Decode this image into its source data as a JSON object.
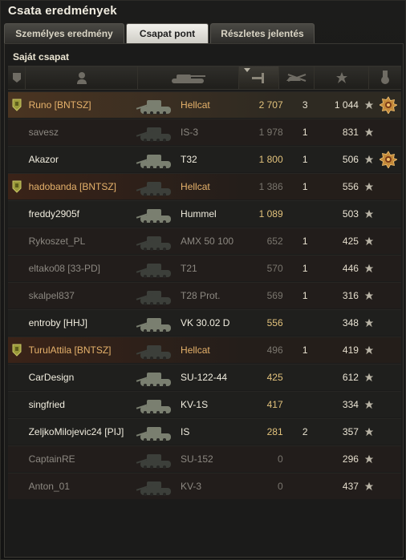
{
  "window": {
    "title": "Csata eredmények"
  },
  "tabs": [
    {
      "label": "Személyes eredmény",
      "active": false
    },
    {
      "label": "Csapat pont",
      "active": true
    },
    {
      "label": "Részletes jelentés",
      "active": false
    }
  ],
  "section_title": "Saját csapat",
  "columns": [
    {
      "icon": "squad-icon"
    },
    {
      "icon": "player-icon"
    },
    {
      "icon": "tank-icon"
    },
    {
      "icon": "damage-icon",
      "sorted": true
    },
    {
      "icon": "kills-icon"
    },
    {
      "icon": "xp-star-icon"
    },
    {
      "icon": "medal-icon"
    }
  ],
  "players": [
    {
      "name": "Runo [BNTSZ]",
      "tank": "Hellcat",
      "damage": "2 707",
      "kills": "3",
      "xp": "1 044",
      "squad": true,
      "dead": false,
      "top": true,
      "medal": true
    },
    {
      "name": "savesz",
      "tank": "IS-3",
      "damage": "1 978",
      "kills": "1",
      "xp": "831",
      "squad": false,
      "dead": true,
      "medal": false
    },
    {
      "name": "Akazor",
      "tank": "T32",
      "damage": "1 800",
      "kills": "1",
      "xp": "506",
      "squad": false,
      "dead": false,
      "medal": true
    },
    {
      "name": "hadobanda [BNTSZ]",
      "tank": "Hellcat",
      "damage": "1 386",
      "kills": "1",
      "xp": "556",
      "squad": true,
      "dead": true,
      "medal": false
    },
    {
      "name": "freddy2905f",
      "tank": "Hummel",
      "damage": "1 089",
      "kills": "",
      "xp": "503",
      "squad": false,
      "dead": false,
      "medal": false
    },
    {
      "name": "Rykoszet_PL",
      "tank": "AMX 50 100",
      "damage": "652",
      "kills": "1",
      "xp": "425",
      "squad": false,
      "dead": true,
      "medal": false
    },
    {
      "name": "eltako08 [33-PD]",
      "tank": "T21",
      "damage": "570",
      "kills": "1",
      "xp": "446",
      "squad": false,
      "dead": true,
      "medal": false
    },
    {
      "name": "skalpel837",
      "tank": "T28 Prot.",
      "damage": "569",
      "kills": "1",
      "xp": "316",
      "squad": false,
      "dead": true,
      "medal": false
    },
    {
      "name": "entroby [HHJ]",
      "tank": "VK 30.02 D",
      "damage": "556",
      "kills": "",
      "xp": "348",
      "squad": false,
      "dead": false,
      "medal": false
    },
    {
      "name": "TurulAttila [BNTSZ]",
      "tank": "Hellcat",
      "damage": "496",
      "kills": "1",
      "xp": "419",
      "squad": true,
      "dead": true,
      "medal": false
    },
    {
      "name": "CarDesign",
      "tank": "SU-122-44",
      "damage": "425",
      "kills": "",
      "xp": "612",
      "squad": false,
      "dead": false,
      "medal": false
    },
    {
      "name": "singfried",
      "tank": "KV-1S",
      "damage": "417",
      "kills": "",
      "xp": "334",
      "squad": false,
      "dead": false,
      "medal": false
    },
    {
      "name": "ZeljkoMilojevic24 [PIJ]",
      "tank": "IS",
      "damage": "281",
      "kills": "2",
      "xp": "357",
      "squad": false,
      "dead": false,
      "medal": false
    },
    {
      "name": "CaptainRE",
      "tank": "SU-152",
      "damage": "0",
      "kills": "",
      "xp": "296",
      "squad": false,
      "dead": true,
      "medal": false
    },
    {
      "name": "Anton_01",
      "tank": "KV-3",
      "damage": "0",
      "kills": "",
      "xp": "437",
      "squad": false,
      "dead": true,
      "medal": false
    }
  ]
}
